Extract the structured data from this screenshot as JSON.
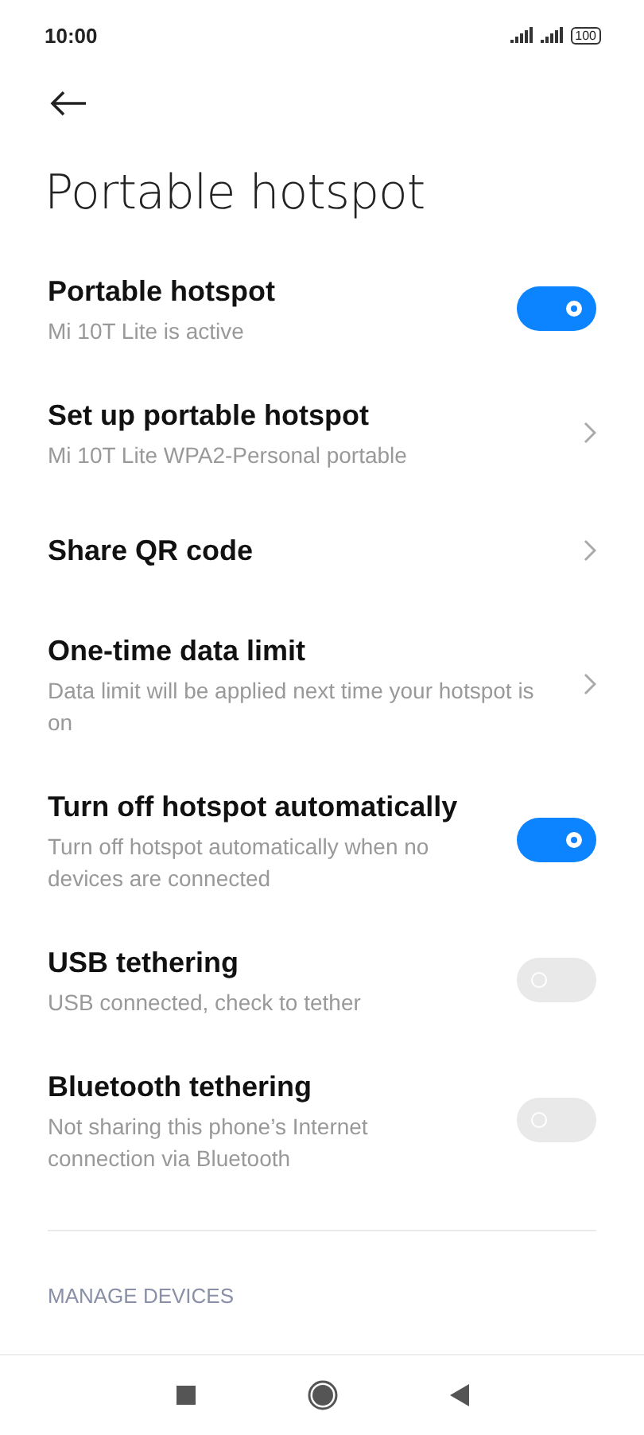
{
  "status_bar": {
    "time": "10:00",
    "battery": "100"
  },
  "title": "Portable hotspot",
  "settings": [
    {
      "kind": "toggle",
      "title": "Portable hotspot",
      "subtitle": "Mi 10T Lite is active",
      "on": true
    },
    {
      "kind": "link",
      "title": "Set up portable hotspot",
      "subtitle": "Mi 10T Lite WPA2-Personal portable"
    },
    {
      "kind": "link",
      "title": "Share QR code"
    },
    {
      "kind": "link",
      "title": "One-time data limit",
      "subtitle": "Data limit will be applied next time your hotspot is on"
    },
    {
      "kind": "toggle",
      "title": "Turn off hotspot automatically",
      "subtitle": "Turn off hotspot automatically when no devices are connected",
      "on": true
    },
    {
      "kind": "toggle",
      "title": "USB tethering",
      "subtitle": "USB connected, check to tether",
      "on": false
    },
    {
      "kind": "toggle",
      "title": "Bluetooth tethering",
      "subtitle": "Not sharing this phone’s Internet connection via Bluetooth",
      "on": false
    }
  ],
  "section_header": "MANAGE DEVICES"
}
